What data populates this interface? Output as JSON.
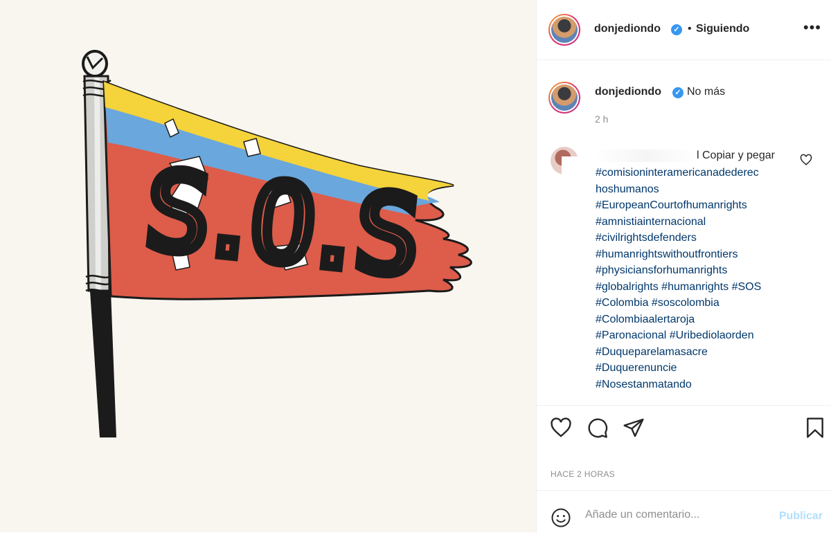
{
  "post": {
    "image": {
      "flag_text": "S.O.S",
      "colors": {
        "yellow": "#f4d33b",
        "blue": "#6aa7dc",
        "red": "#dd5c4a",
        "pole": "#1b1b1b",
        "background": "#f8f6ef"
      }
    },
    "header": {
      "username": "donjediondo",
      "separator": "•",
      "follow_status": "Siguiendo",
      "more_icon": "more-horizontal-icon"
    },
    "caption": {
      "username": "donjediondo",
      "text": "No más",
      "age": "2 h"
    },
    "comment": {
      "lead_text": "l Copiar y pegar",
      "hashtags": [
        "#comisioninteramericanadederec",
        "hoshumanos",
        "#EuropeanCourtofhumanrights",
        "#amnistiainternacional",
        "#civilrightsdefenders",
        "#humanrightswithoutfrontiers",
        "#physiciansforhumanrights",
        "#globalrights #humanrights #SOS",
        "#Colombia #soscolombia",
        "#Colombiaalertaroja",
        "#Paronacional #Uribediolaorden",
        "#Duqueparelamasacre",
        "#Duquerenuncie",
        "#Nosestanmatando"
      ],
      "like_icon": "heart-outline-icon"
    },
    "actions": {
      "like_icon": "heart-icon",
      "comment_icon": "comment-icon",
      "share_icon": "send-icon",
      "save_icon": "bookmark-icon"
    },
    "timestamp": "HACE 2 HORAS",
    "comment_box": {
      "emoji_icon": "emoji-icon",
      "placeholder": "Añade un comentario...",
      "publish_label": "Publicar"
    },
    "accent_colors": {
      "link": "#00376b",
      "verified": "#3897f0",
      "publish_disabled": "#b2dffc",
      "muted": "#8e8e8e"
    }
  }
}
